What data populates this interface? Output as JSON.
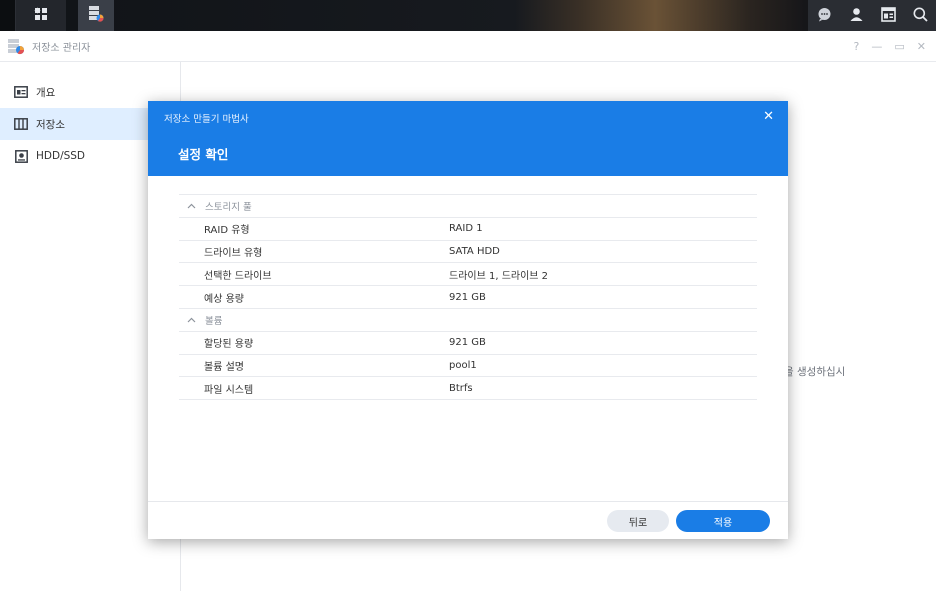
{
  "taskbar": {
    "icons_left": [
      "apps-grid-icon",
      "storage-manager-icon"
    ],
    "icons_right": [
      "chat-icon",
      "user-icon",
      "widgets-icon",
      "search-icon"
    ]
  },
  "window": {
    "title": "저장소 관리자",
    "controls": [
      "?",
      "—",
      "▭",
      "✕"
    ]
  },
  "sidebar": {
    "items": [
      {
        "label": "개요",
        "icon": "overview-icon"
      },
      {
        "label": "저장소",
        "icon": "storage-icon",
        "active": true
      },
      {
        "label": "HDD/SSD",
        "icon": "drive-icon"
      }
    ]
  },
  "background": {
    "hint_text": "을 생성하십시"
  },
  "wizard": {
    "subtitle": "저장소 만들기 마법사",
    "title": "설정 확인",
    "close": "✕",
    "groups": [
      {
        "label": "스토리지 풀",
        "rows": [
          {
            "key": "RAID 유형",
            "value": "RAID 1"
          },
          {
            "key": "드라이브 유형",
            "value": "SATA HDD"
          },
          {
            "key": "선택한 드라이브",
            "value": "드라이브 1, 드라이브 2"
          },
          {
            "key": "예상 용량",
            "value": "921 GB"
          }
        ]
      },
      {
        "label": "볼륨",
        "rows": [
          {
            "key": "할당된 용량",
            "value": "921 GB"
          },
          {
            "key": "볼륨 설명",
            "value": "pool1"
          },
          {
            "key": "파일 시스템",
            "value": "Btrfs"
          }
        ]
      }
    ],
    "buttons": {
      "back": "뒤로",
      "apply": "적용"
    }
  },
  "colors": {
    "accent": "#1a7de6",
    "sidebar_active": "#dfeeff"
  }
}
